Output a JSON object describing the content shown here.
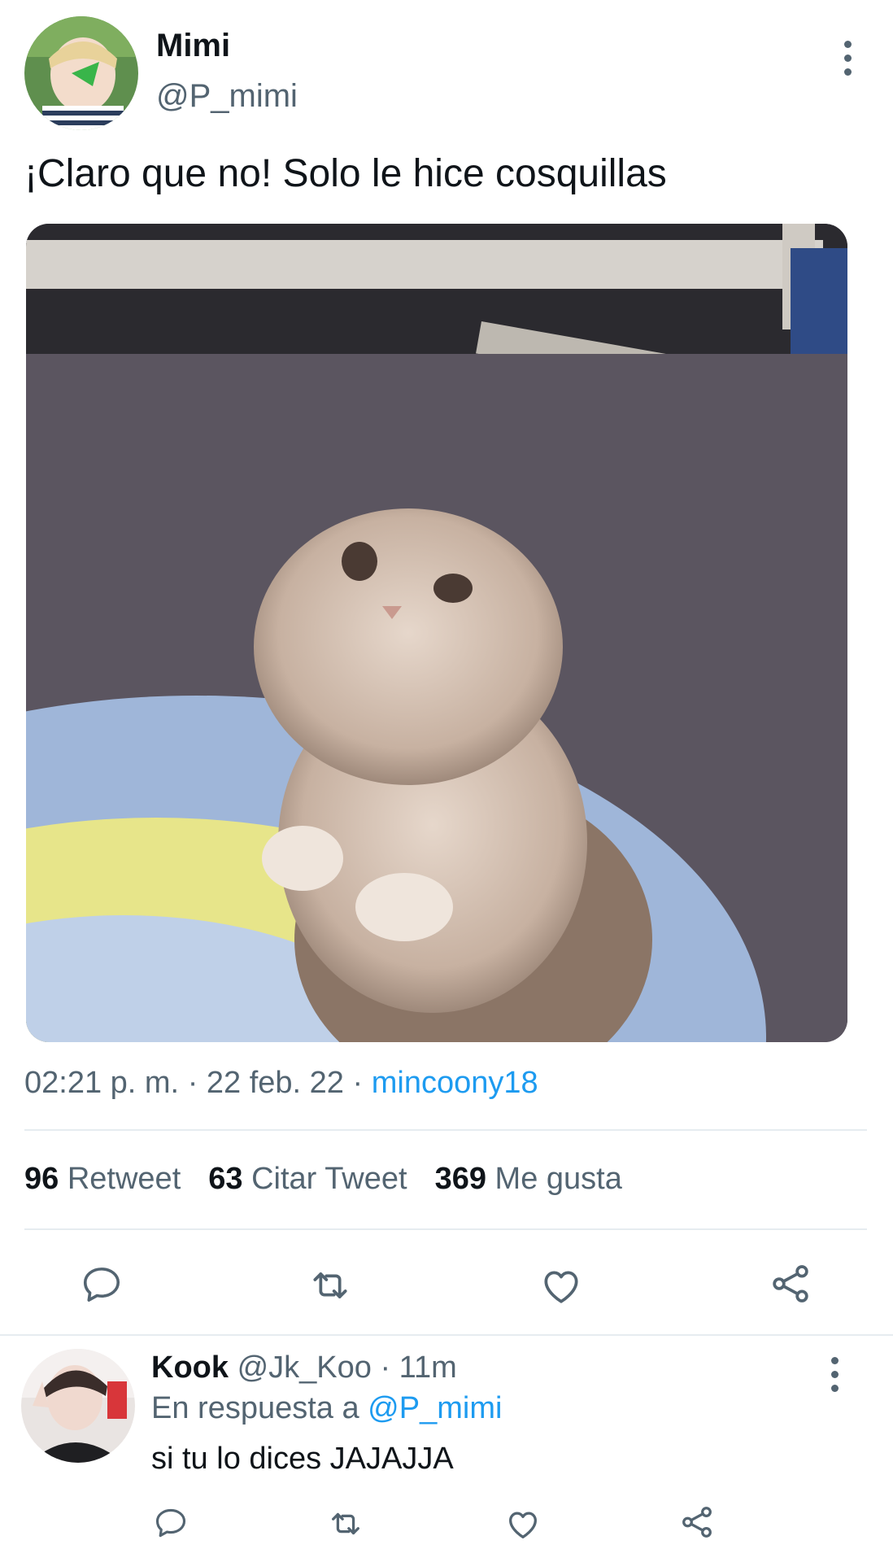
{
  "tweet": {
    "author_name": "Mimi",
    "author_handle": "@P_mimi",
    "text": "¡Claro que no! Solo le hice cosquillas",
    "time": "02:21 p. m.",
    "date": "22 feb. 22",
    "separator": "·",
    "source": "mincoony18"
  },
  "stats": [
    {
      "count": "96",
      "label": "Retweet"
    },
    {
      "count": "63",
      "label": "Citar Tweet"
    },
    {
      "count": "369",
      "label": "Me gusta"
    }
  ],
  "reply": {
    "author_name": "Kook",
    "author_handle": "@Jk_Koo",
    "dot": "·",
    "age": "11m",
    "replying_prefix": "En respuesta a",
    "replying_to": "@P_mimi",
    "text": "si tu lo dices JAJAJJA"
  },
  "icons": {
    "reply": "reply-icon",
    "retweet": "retweet-icon",
    "like": "heart-icon",
    "share": "share-icon",
    "more": "more-options-icon"
  },
  "colors": {
    "link": "#1d9bf0",
    "muted": "#536471",
    "text": "#0f1419",
    "divider": "#e6ecf0"
  }
}
